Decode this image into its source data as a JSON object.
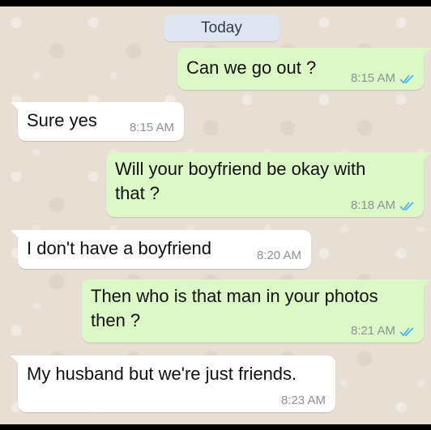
{
  "chat": {
    "date_label": "Today",
    "messages": [
      {
        "direction": "out",
        "text": "Can we go out ?",
        "time": "8:15 AM",
        "status_icon": "double-check-icon"
      },
      {
        "direction": "in",
        "text": "Sure yes",
        "time": "8:15 AM"
      },
      {
        "direction": "out",
        "text": "Will your boyfriend be okay with\nthat ?",
        "time": "8:18 AM",
        "status_icon": "double-check-icon"
      },
      {
        "direction": "in",
        "text": "I don't have a boyfriend",
        "time": "8:20 AM"
      },
      {
        "direction": "out",
        "text": "Then who is that man in your photos\nthen ?",
        "time": "8:21 AM",
        "status_icon": "double-check-icon"
      },
      {
        "direction": "in",
        "text": "My husband but we're just friends.",
        "time": "8:23 AM"
      }
    ]
  },
  "colors": {
    "outgoing_bubble": "#dcf8c6",
    "incoming_bubble": "#ffffff",
    "read_ticks": "#4fb6ec",
    "background": "#e7dfd4"
  }
}
